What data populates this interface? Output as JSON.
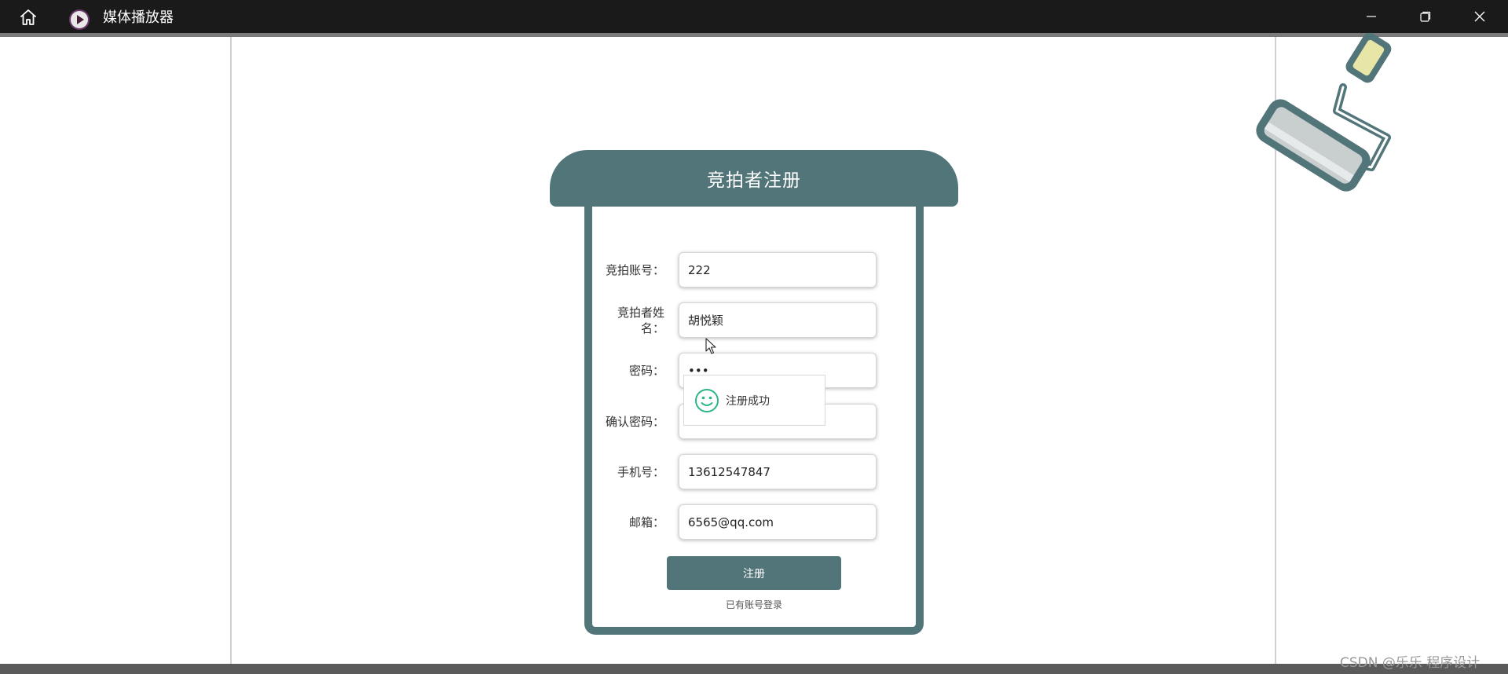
{
  "window": {
    "title": "媒体播放器",
    "icons": {
      "home": "home-icon",
      "app": "play-icon",
      "minimize": "minimize-icon",
      "maximize": "restore-icon",
      "close": "close-icon"
    }
  },
  "form": {
    "title": "竞拍者注册",
    "fields": {
      "account": {
        "label": "竞拍账号：",
        "value": "222"
      },
      "name": {
        "label_line1": "竞拍者姓",
        "label_line2": "名：",
        "value": "胡悦颖"
      },
      "password": {
        "label": "密码：",
        "value": "•••"
      },
      "confirm": {
        "label": "确认密码：",
        "value": ""
      },
      "phone": {
        "label": "手机号：",
        "value": "13612547847"
      },
      "email": {
        "label": "邮箱：",
        "value": "6565@qq.com"
      }
    },
    "submit_label": "注册",
    "login_link": "已有账号登录"
  },
  "toast": {
    "text": "注册成功",
    "icon": "smile-icon"
  },
  "watermark": "CSDN @乐乐 程序设计",
  "colors": {
    "accent": "#527579",
    "titlebar": "#1a1a1a",
    "toast_icon": "#2bb68a"
  }
}
